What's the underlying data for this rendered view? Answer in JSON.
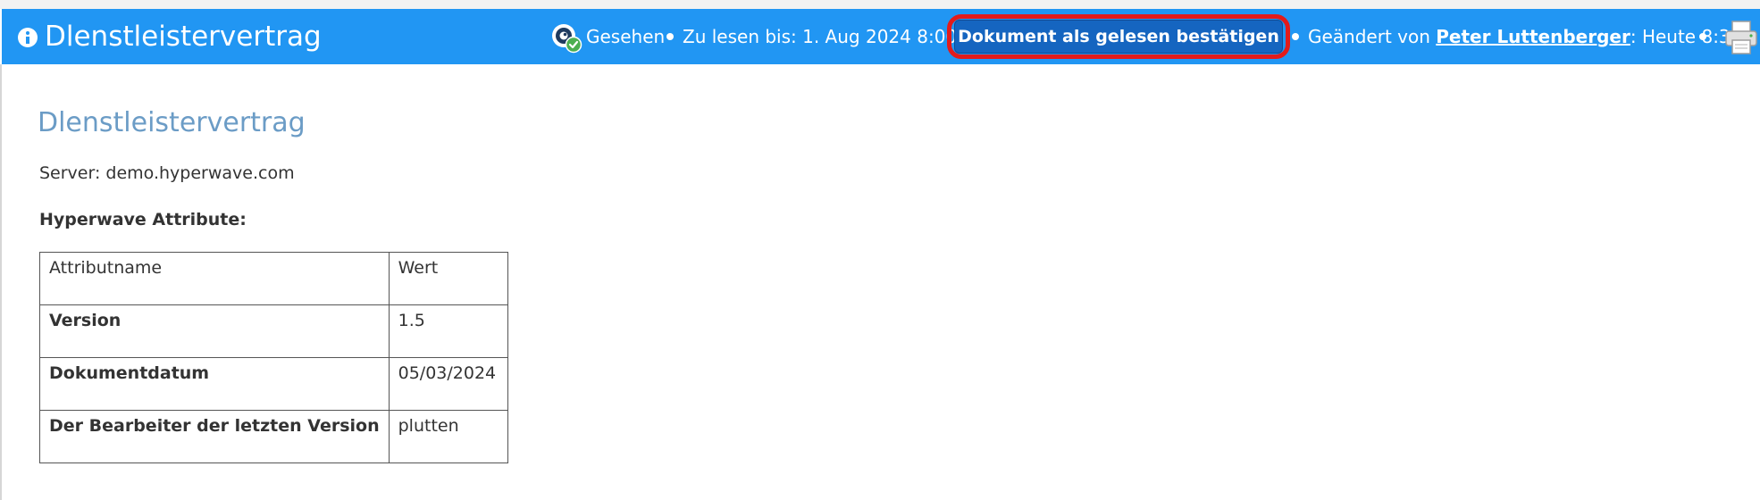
{
  "header": {
    "title": "Dlenstleistervertrag",
    "status_seen": "Gesehen",
    "read_until": "Zu lesen bis: 1. Aug 2024 8:00",
    "confirm_button_label": "Dokument als gelesen bestätigen",
    "changed_by_prefix": "Geändert von ",
    "changed_by_user": "Peter Luttenberger",
    "changed_by_suffix": ": Heute 8:36",
    "icons": [
      "info-icon",
      "seen-eye-icon",
      "printer-icon"
    ],
    "colors": {
      "header_bg": "#2196f3",
      "button_bg": "#1565c0",
      "highlight_ring": "#e21b1b"
    }
  },
  "document": {
    "title": "Dlenstleistervertrag",
    "server_line": "Server: demo.hyperwave.com",
    "attributes_heading": "Hyperwave Attribute:",
    "title_color": "#6b9cc6"
  },
  "attributes_table": {
    "header": {
      "name": "Attributname",
      "value": "Wert"
    },
    "rows": [
      {
        "name": "Version",
        "value": "1.5"
      },
      {
        "name": "Dokumentdatum",
        "value": "05/03/2024"
      },
      {
        "name": "Der Bearbeiter der letzten Version",
        "value": "plutten"
      }
    ]
  }
}
